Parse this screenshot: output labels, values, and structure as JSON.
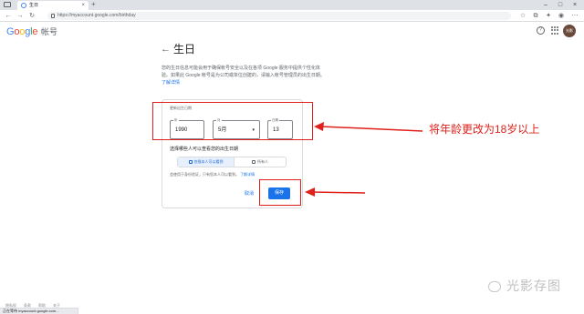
{
  "browser": {
    "tab_title": "生日",
    "url": "https://myaccount.google.com/birthday"
  },
  "header": {
    "logo": [
      "G",
      "o",
      "o",
      "g",
      "l",
      "e"
    ],
    "product": "帐号",
    "help_icon": "?",
    "avatar_text": "光影"
  },
  "page": {
    "back_arrow": "←",
    "title": "生日",
    "intro_text": "您的生日信息可能会用于确保帐号安全以及在各项 Google 服务中提供个性化体验。如果此 Google 帐号是为公司或单位创建的，请输入帐号管理员的出生日期。",
    "intro_link": "了解详情"
  },
  "form": {
    "field_label": "更新出生日期",
    "year": {
      "label": "年",
      "value": "1990"
    },
    "month": {
      "label": "月",
      "value": "5月",
      "caret": "▾"
    },
    "day": {
      "label": "日期",
      "value": "13"
    },
    "visibility_title": "选择哪些人可以查看您的出生日期",
    "visibility_options": [
      "仅限本人可以看到",
      "所有人"
    ],
    "note_text": "会使用于身份验证，只有您本人可以看到。",
    "note_link": "了解详情",
    "cancel_label": "取消",
    "save_label": "保存"
  },
  "annotation": {
    "text": "将年龄更改为18岁以上",
    "color": "#e0201a"
  },
  "footer": {
    "links": [
      "隐私权",
      "条款",
      "帮助",
      "关于"
    ],
    "status": "正在等待 myaccount.google.com..."
  },
  "watermark": "光影存图"
}
